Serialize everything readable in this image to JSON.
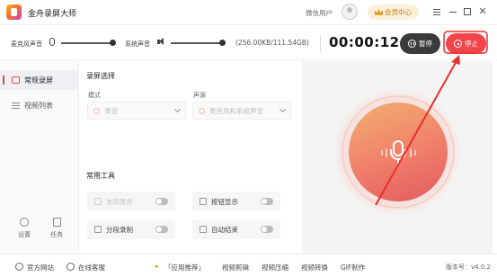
{
  "app": {
    "title": "金舟录屏大师",
    "user_label": "微信用户",
    "member_button": "会员中心"
  },
  "controls": {
    "mic_label": "麦克风声音",
    "system_label": "系统声音",
    "storage": "(256.00KB/111.54GB)",
    "timer": "00:00:12",
    "pause_label": "暂停",
    "stop_label": "停止"
  },
  "sidebar": {
    "items": [
      {
        "label": "常规录屏",
        "active": true
      },
      {
        "label": "视频列表",
        "active": false
      }
    ],
    "bottom": [
      {
        "label": "设置",
        "icon": "gear-icon"
      },
      {
        "label": "任务",
        "icon": "task-icon"
      }
    ]
  },
  "main": {
    "record_section": "录屏选择",
    "mode_label": "模式",
    "mode_value": "录音",
    "source_label": "声源",
    "source_value": "麦克风和系统声音",
    "tools_section": "常用工具",
    "tools": [
      {
        "label": "水印显示",
        "enabled": false
      },
      {
        "label": "按钮显示",
        "enabled": true
      },
      {
        "label": "分段录制",
        "enabled": true
      },
      {
        "label": "自动结束",
        "enabled": true
      }
    ]
  },
  "footer": {
    "website": "官方网站",
    "support": "在线客服",
    "recommend": "「应用推荐」",
    "links": [
      "视频剪辑",
      "视频压缩",
      "视频转换",
      "GIF制作"
    ],
    "version": "版本号：v4.0.2"
  },
  "colors": {
    "accent_red": "#f0464c",
    "orb_gradient": [
      "#f3b070",
      "#e25a62"
    ]
  }
}
